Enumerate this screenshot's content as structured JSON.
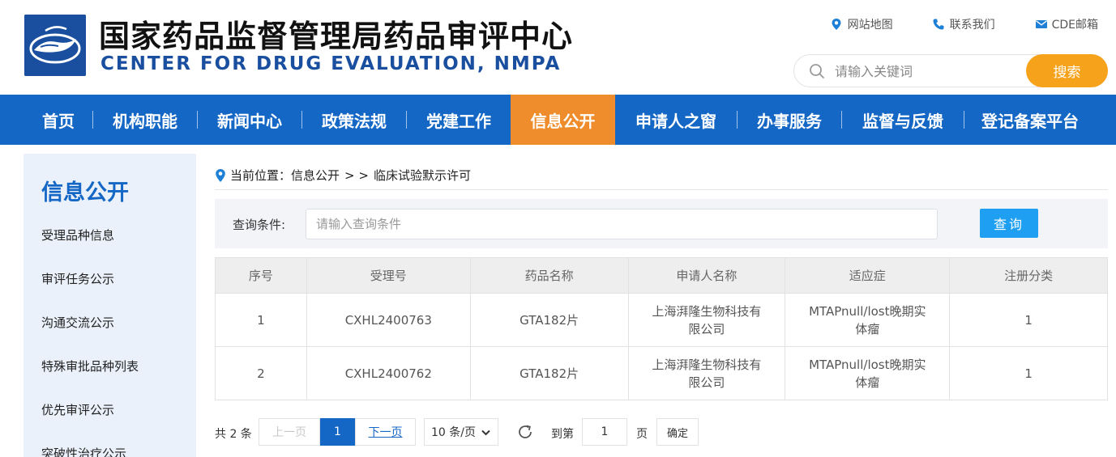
{
  "header": {
    "title_cn": "国家药品监督管理局药品审评中心",
    "title_en": "CENTER FOR DRUG EVALUATION, NMPA",
    "links": [
      {
        "label": "网站地图",
        "icon": "location-pin-icon"
      },
      {
        "label": "联系我们",
        "icon": "phone-icon"
      },
      {
        "label": "CDE邮箱",
        "icon": "mail-icon"
      }
    ],
    "search": {
      "placeholder": "请输入关键词",
      "button": "搜索"
    }
  },
  "nav": {
    "items": [
      {
        "label": "首页"
      },
      {
        "label": "机构职能"
      },
      {
        "label": "新闻中心"
      },
      {
        "label": "政策法规"
      },
      {
        "label": "党建工作"
      },
      {
        "label": "信息公开",
        "active": true
      },
      {
        "label": "申请人之窗"
      },
      {
        "label": "办事服务"
      },
      {
        "label": "监督与反馈"
      },
      {
        "label": "登记备案平台"
      }
    ]
  },
  "sidebar": {
    "title": "信息公开",
    "items": [
      {
        "label": "受理品种信息"
      },
      {
        "label": "审评任务公示"
      },
      {
        "label": "沟通交流公示"
      },
      {
        "label": "特殊审批品种列表"
      },
      {
        "label": "优先审评公示"
      },
      {
        "label": "突破性治疗公示"
      }
    ]
  },
  "breadcrumb": {
    "prefix": "当前位置：",
    "parent": "信息公开",
    "separator": "> >",
    "current": "临床试验默示许可"
  },
  "query": {
    "label": "查询条件:",
    "placeholder": "请输入查询条件",
    "button": "查询"
  },
  "table": {
    "columns": [
      "序号",
      "受理号",
      "药品名称",
      "申请人名称",
      "适应症",
      "注册分类"
    ],
    "rows": [
      [
        "1",
        "CXHL2400763",
        "GTA182片",
        "上海湃隆生物科技有限公司",
        "MTAPnull/lost晚期实体瘤",
        "1"
      ],
      [
        "2",
        "CXHL2400762",
        "GTA182片",
        "上海湃隆生物科技有限公司",
        "MTAPnull/lost晚期实体瘤",
        "1"
      ]
    ]
  },
  "pager": {
    "total": "共 2 条",
    "prev": "上一页",
    "current": "1",
    "next": "下一页",
    "page_size": "10 条/页",
    "goto_label": "到第",
    "goto_value": "1",
    "page_suffix": "页",
    "confirm": "确定"
  },
  "colors": {
    "brand_blue": "#1467c5",
    "nav_active": "#ef8c2b",
    "search_button": "#f7a21b",
    "query_button": "#1e9ff2"
  }
}
